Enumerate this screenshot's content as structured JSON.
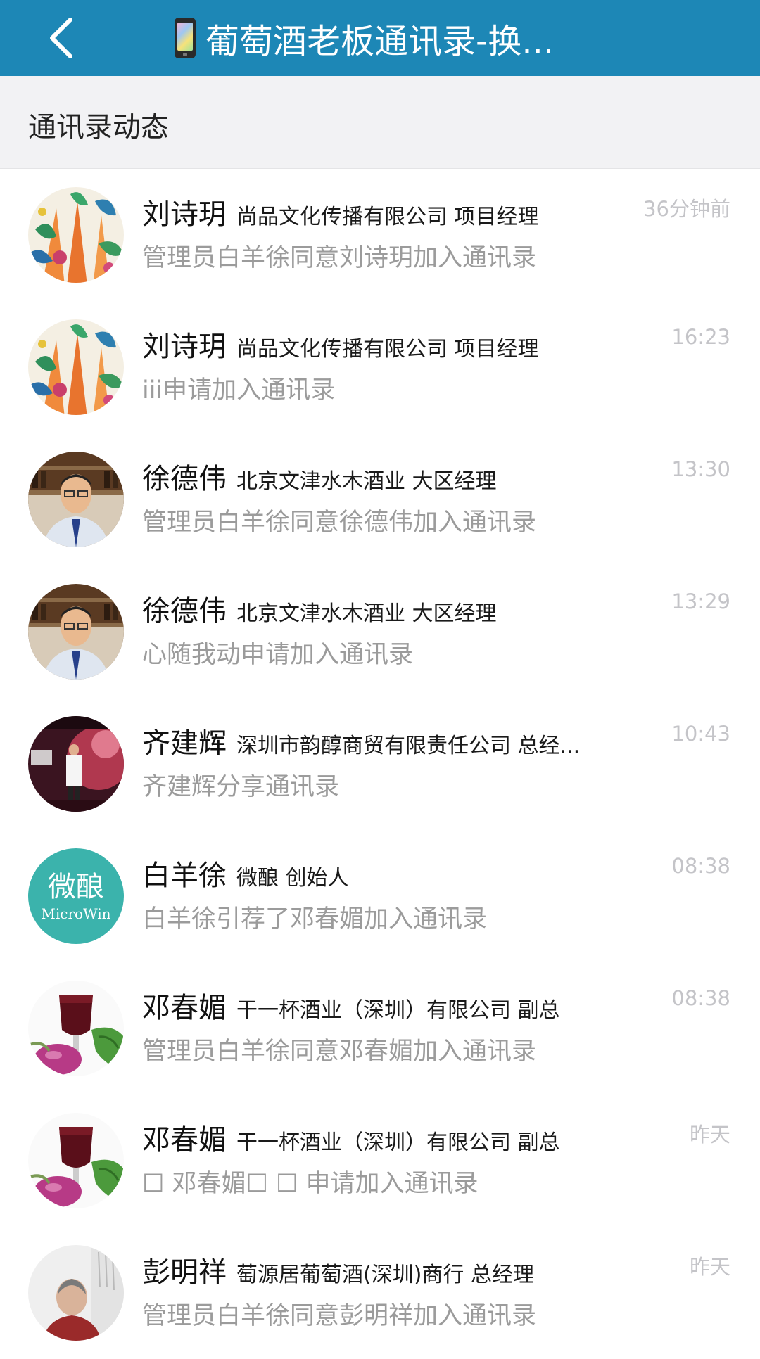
{
  "nav": {
    "title": "葡萄酒老板通讯录-换..."
  },
  "section": {
    "title": "通讯录动态"
  },
  "items": [
    {
      "name": "刘诗玥",
      "company": "尚品文化传播有限公司 项目经理",
      "message": "管理员白羊徐同意刘诗玥加入通讯录",
      "time": "36分钟前",
      "avatar": "veggie"
    },
    {
      "name": "刘诗玥",
      "company": "尚品文化传播有限公司 项目经理",
      "message": "iii申请加入通讯录",
      "time": "16:23",
      "avatar": "veggie"
    },
    {
      "name": "徐德伟",
      "company": "北京文津水木酒业 大区经理",
      "message": "管理员白羊徐同意徐德伟加入通讯录",
      "time": "13:30",
      "avatar": "man"
    },
    {
      "name": "徐德伟",
      "company": "北京文津水木酒业 大区经理",
      "message": "心随我动申请加入通讯录",
      "time": "13:29",
      "avatar": "man"
    },
    {
      "name": "齐建辉",
      "company": "深圳市韵醇商贸有限责任公司 总经...",
      "message": "齐建辉分享通讯录",
      "time": "10:43",
      "avatar": "expo"
    },
    {
      "name": "白羊徐",
      "company": "微酿 创始人",
      "message": "白羊徐引荐了邓春媚加入通讯录",
      "time": "08:38",
      "avatar": "logo",
      "avatar_text": [
        "微酿",
        "MicroWin"
      ]
    },
    {
      "name": "邓春媚",
      "company": "干一杯酒业（深圳）有限公司 副总",
      "message": "管理员白羊徐同意邓春媚加入通讯录",
      "time": "08:38",
      "avatar": "wine"
    },
    {
      "name": "邓春媚",
      "company": "干一杯酒业（深圳）有限公司 副总",
      "message": "☐ 邓春媚☐ ☐ 申请加入通讯录",
      "time": "昨天",
      "avatar": "wine"
    },
    {
      "name": "彭明祥",
      "company": "萄源居葡萄酒(深圳)商行 总经理",
      "message": "管理员白羊徐同意彭明祥加入通讯录",
      "time": "昨天",
      "avatar": "portrait"
    }
  ]
}
